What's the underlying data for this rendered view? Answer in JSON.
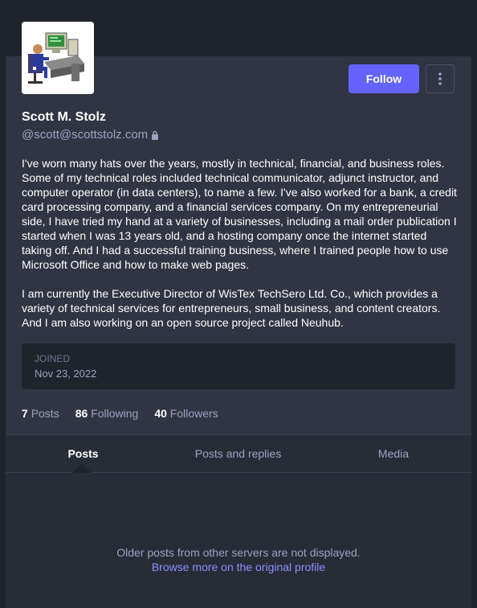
{
  "profile": {
    "display_name": "Scott M. Stolz",
    "handle": "@scott@scottstolz.com",
    "follow_label": "Follow",
    "bio": [
      "I've worn many hats over the years, mostly in technical, financial, and business roles. Some of my technical roles included technical communicator, adjunct instructor, and computer operator (in data centers), to name a few. I've also worked for a bank, a credit card processing company, and a financial services company. On my entrepreneurial side, I have tried my hand at a variety of businesses, including a mail order publication I started when I was 13 years old, and a hosting company once the internet started taking off. And I had a successful training business, where I trained people how to use Microsoft Office and how to make web pages.",
      "I am currently the Executive Director of WisTex TechSero Ltd. Co., which provides a variety of technical services for entrepreneurs, small business, and content creators. And I am also working on an open source project called Neuhub."
    ],
    "joined_label": "JOINED",
    "joined_date": "Nov 23, 2022"
  },
  "counts": {
    "posts_num": "7",
    "posts_label": "Posts",
    "following_num": "86",
    "following_label": "Following",
    "followers_num": "40",
    "followers_label": "Followers"
  },
  "tabs": [
    {
      "label": "Posts"
    },
    {
      "label": "Posts and replies"
    },
    {
      "label": "Media"
    }
  ],
  "empty": {
    "message": "Older posts from other servers are not displayed.",
    "link": "Browse more on the original profile"
  },
  "icons": {
    "lock": "lock-icon",
    "menu": "kebab-menu-icon"
  }
}
